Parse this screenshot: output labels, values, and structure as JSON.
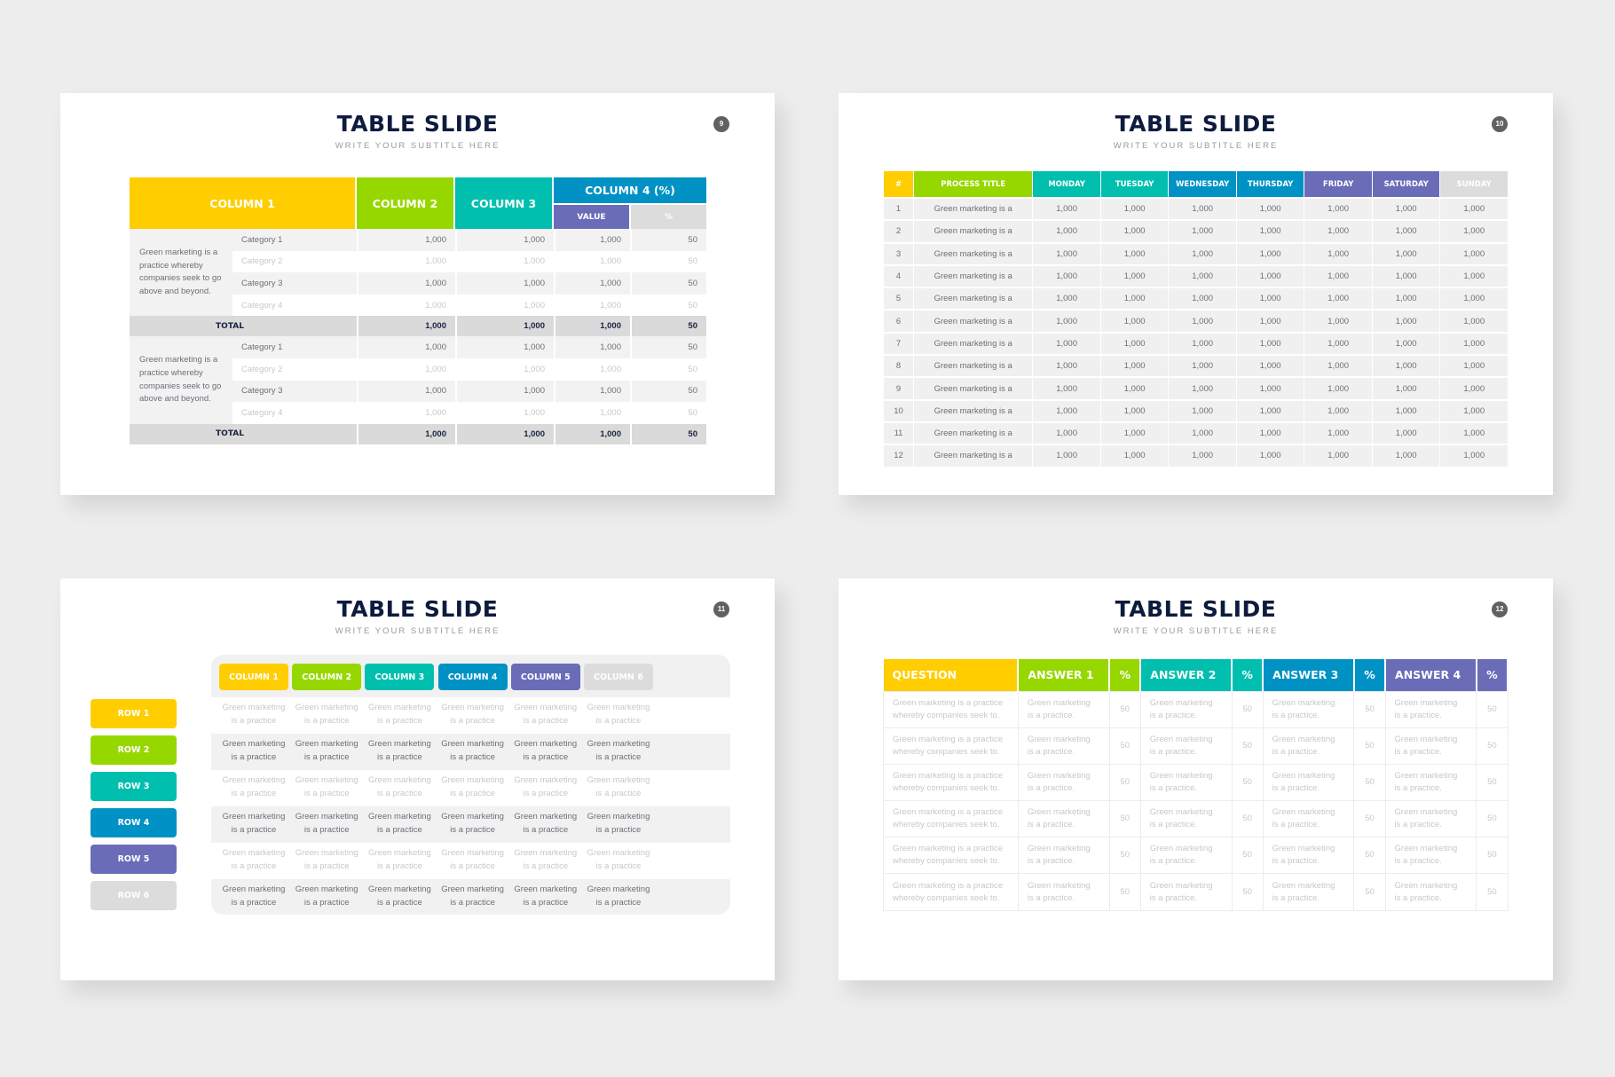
{
  "slides": [
    {
      "title": "TABLE SLIDE",
      "subtitle": "WRITE YOUR SUBTITLE HERE",
      "page_number": "9",
      "table": {
        "headers": {
          "col1": "COLUMN 1",
          "col2": "COLUMN 2",
          "col3": "COLUMN 3",
          "col4": "COLUMN 4 (%)",
          "col4_value": "VALUE",
          "col4_pct": "%"
        },
        "groups": [
          {
            "description": "Green marketing is a practice whereby companies seek to go above and beyond.",
            "rows": [
              {
                "category": "Category 1",
                "col2": "1,000",
                "col3": "1,000",
                "value": "1,000",
                "pct": "50"
              },
              {
                "category": "Category 2",
                "col2": "1,000",
                "col3": "1,000",
                "value": "1,000",
                "pct": "50"
              },
              {
                "category": "Category 3",
                "col2": "1,000",
                "col3": "1,000",
                "value": "1,000",
                "pct": "50"
              },
              {
                "category": "Category 4",
                "col2": "1,000",
                "col3": "1,000",
                "value": "1,000",
                "pct": "50"
              }
            ],
            "total": {
              "label": "TOTAL",
              "col2": "1,000",
              "col3": "1,000",
              "value": "1,000",
              "pct": "50"
            }
          },
          {
            "description": "Green marketing is a practice whereby companies seek to go above and beyond.",
            "rows": [
              {
                "category": "Category 1",
                "col2": "1,000",
                "col3": "1,000",
                "value": "1,000",
                "pct": "50"
              },
              {
                "category": "Category 2",
                "col2": "1,000",
                "col3": "1,000",
                "value": "1,000",
                "pct": "50"
              },
              {
                "category": "Category 3",
                "col2": "1,000",
                "col3": "1,000",
                "value": "1,000",
                "pct": "50"
              },
              {
                "category": "Category 4",
                "col2": "1,000",
                "col3": "1,000",
                "value": "1,000",
                "pct": "50"
              }
            ],
            "total": {
              "label": "TOTAL",
              "col2": "1,000",
              "col3": "1,000",
              "value": "1,000",
              "pct": "50"
            }
          }
        ]
      }
    },
    {
      "title": "TABLE SLIDE",
      "subtitle": "WRITE YOUR SUBTITLE HERE",
      "page_number": "10",
      "table": {
        "headers": [
          "#",
          "PROCESS TITLE",
          "MONDAY",
          "TUESDAY",
          "WEDNESDAY",
          "THURSDAY",
          "FRIDAY",
          "SATURDAY",
          "SUNDAY"
        ],
        "rows": [
          [
            "1",
            "Green marketing is a",
            "1,000",
            "1,000",
            "1,000",
            "1,000",
            "1,000",
            "1,000",
            "1,000"
          ],
          [
            "2",
            "Green marketing is a",
            "1,000",
            "1,000",
            "1,000",
            "1,000",
            "1,000",
            "1,000",
            "1,000"
          ],
          [
            "3",
            "Green marketing is a",
            "1,000",
            "1,000",
            "1,000",
            "1,000",
            "1,000",
            "1,000",
            "1,000"
          ],
          [
            "4",
            "Green marketing is a",
            "1,000",
            "1,000",
            "1,000",
            "1,000",
            "1,000",
            "1,000",
            "1,000"
          ],
          [
            "5",
            "Green marketing is a",
            "1,000",
            "1,000",
            "1,000",
            "1,000",
            "1,000",
            "1,000",
            "1,000"
          ],
          [
            "6",
            "Green marketing is a",
            "1,000",
            "1,000",
            "1,000",
            "1,000",
            "1,000",
            "1,000",
            "1,000"
          ],
          [
            "7",
            "Green marketing is a",
            "1,000",
            "1,000",
            "1,000",
            "1,000",
            "1,000",
            "1,000",
            "1,000"
          ],
          [
            "8",
            "Green marketing is a",
            "1,000",
            "1,000",
            "1,000",
            "1,000",
            "1,000",
            "1,000",
            "1,000"
          ],
          [
            "9",
            "Green marketing is a",
            "1,000",
            "1,000",
            "1,000",
            "1,000",
            "1,000",
            "1,000",
            "1,000"
          ],
          [
            "10",
            "Green marketing is a",
            "1,000",
            "1,000",
            "1,000",
            "1,000",
            "1,000",
            "1,000",
            "1,000"
          ],
          [
            "11",
            "Green marketing is a",
            "1,000",
            "1,000",
            "1,000",
            "1,000",
            "1,000",
            "1,000",
            "1,000"
          ],
          [
            "12",
            "Green marketing is a",
            "1,000",
            "1,000",
            "1,000",
            "1,000",
            "1,000",
            "1,000",
            "1,000"
          ]
        ]
      }
    },
    {
      "title": "TABLE SLIDE",
      "subtitle": "WRITE YOUR SUBTITLE HERE",
      "page_number": "11",
      "table": {
        "columns": [
          "COLUMN 1",
          "COLUMN 2",
          "COLUMN 3",
          "COLUMN 4",
          "COLUMN 5",
          "COLUMN 6"
        ],
        "rows": [
          "ROW 1",
          "ROW 2",
          "ROW 3",
          "ROW 4",
          "ROW 5",
          "ROW 6"
        ],
        "cell_text": [
          "Green marketing",
          "is a practice"
        ]
      }
    },
    {
      "title": "TABLE SLIDE",
      "subtitle": "WRITE YOUR SUBTITLE HERE",
      "page_number": "12",
      "table": {
        "headers": [
          "QUESTION",
          "ANSWER 1",
          "%",
          "ANSWER 2",
          "%",
          "ANSWER 3",
          "%",
          "ANSWER 4",
          "%"
        ],
        "question_text": [
          "Green marketing is a practice",
          "whereby companies seek to."
        ],
        "answer_text": [
          "Green marketing",
          "is a practice."
        ],
        "pct_value": "50",
        "row_count": 6
      }
    }
  ],
  "colors": {
    "yellow": "#ffcd00",
    "green": "#97d700",
    "teal": "#00bfae",
    "blue": "#0092c4",
    "purple": "#6a6cb8",
    "gray": "#dcdcdc",
    "title": "#0d1b3e"
  }
}
